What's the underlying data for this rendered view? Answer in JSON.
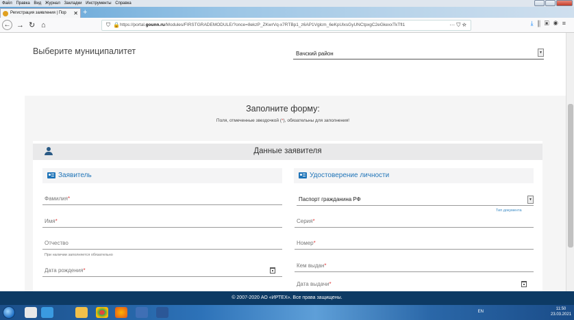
{
  "browser": {
    "menu": [
      "Файл",
      "Правка",
      "Вид",
      "Журнал",
      "Закладки",
      "Инструменты",
      "Справка"
    ],
    "tab_title": "Регистрация заявления | Пор",
    "url_prefix": "https://portal.",
    "url_domain": "gounn.ru",
    "url_rest": "/Modules/FIRSTGRADEMODULE/?once=8ekzP_ZKwrVq-x7RTBp1_z6AP1Vglcm_6eKpUlxsGyUNCtpxgC2eGkexxTkTfl1"
  },
  "municipality": {
    "label": "Выберите муниципалитет",
    "selected": "Вачский район"
  },
  "form": {
    "title": "Заполните форму:",
    "note_before": "Поля, отмеченные звездочкой (",
    "note_star": "*",
    "note_after": "), обязательны для заполнения!",
    "section_title": "Данные заявителя",
    "applicant": {
      "heading": "Заявитель",
      "surname": "Фамилия",
      "name": "Имя",
      "patronymic": "Отчество",
      "patronymic_hint": "При наличии заполняется обязательно",
      "birthdate": "Дата рождения",
      "star": "*"
    },
    "identity": {
      "heading": "Удостоверение личности",
      "doc_type_value": "Паспорт гражданина РФ",
      "doc_type_hint": "Тип документа",
      "series": "Серия",
      "number": "Номер",
      "issued_by": "Кем выдан",
      "issue_date": "Дата выдачи",
      "star": "*"
    }
  },
  "footer": {
    "copyright": "© 2007-2020 АО «ИРТЕХ». Все права защищены."
  },
  "taskbar": {
    "lang": "EN",
    "time": "11:50",
    "date": "23.03.2021"
  },
  "colors": {
    "accent": "#1f74b8",
    "footer": "#0d3a64",
    "required": "#e04040"
  }
}
